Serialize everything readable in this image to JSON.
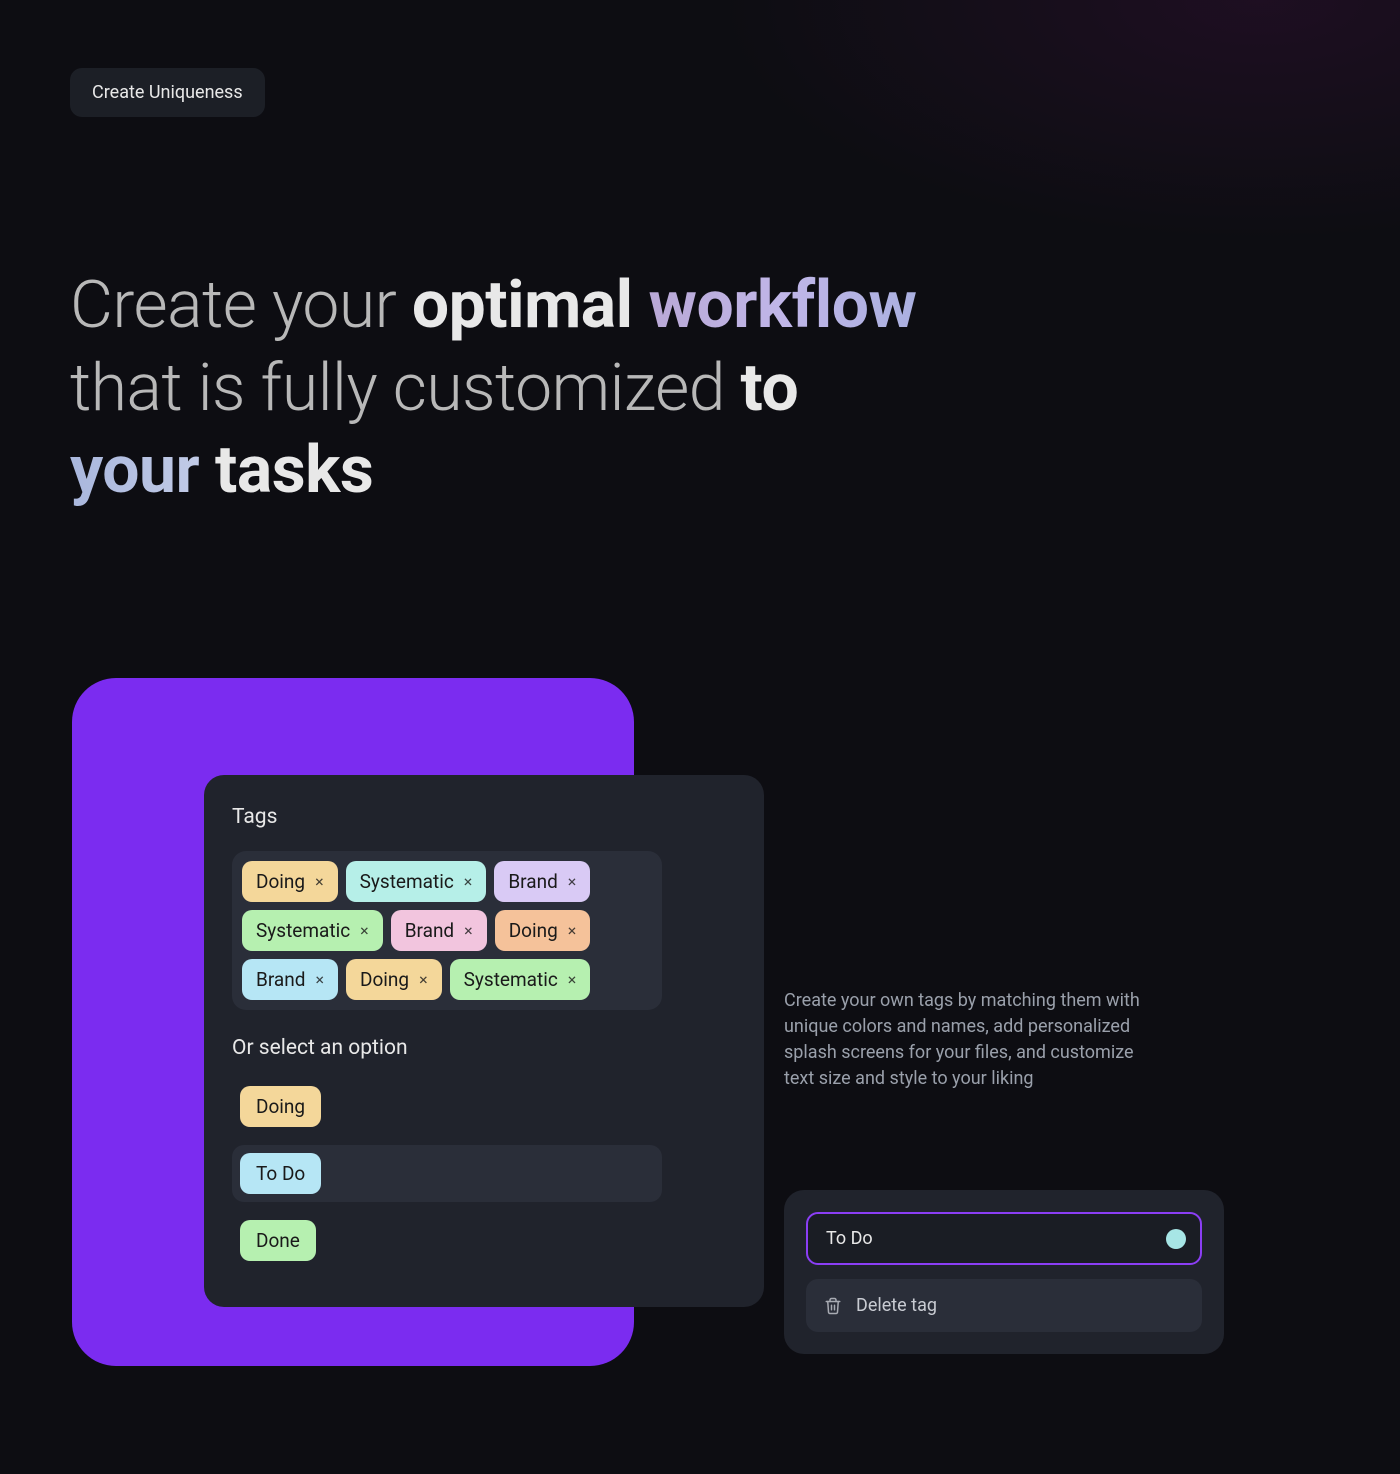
{
  "badge": "Create Uniqueness",
  "headline": {
    "part1": "Create your ",
    "bold1": "optimal ",
    "grad1": "workflow",
    "part2": "that is fully customized ",
    "bold2": "to",
    "grad2": "your ",
    "bold3": "tasks"
  },
  "tags_panel": {
    "title": "Tags",
    "rows": [
      [
        {
          "label": "Doing",
          "color": "#f4d79a"
        },
        {
          "label": "Systematic",
          "color": "#b6efe8"
        },
        {
          "label": "Brand",
          "color": "#d9caf5"
        }
      ],
      [
        {
          "label": "Systematic",
          "color": "#b6f0b0"
        },
        {
          "label": "Brand",
          "color": "#f2c5de"
        },
        {
          "label": "Doing",
          "color": "#f5c29a"
        }
      ],
      [
        {
          "label": "Brand",
          "color": "#b6e6f5"
        },
        {
          "label": "Doing",
          "color": "#f4d79a"
        },
        {
          "label": "Systematic",
          "color": "#b6f0b0"
        }
      ]
    ],
    "subhead": "Or select an option",
    "options": [
      {
        "label": "Doing",
        "color": "#f4d79a",
        "highlighted": false
      },
      {
        "label": "To Do",
        "color": "#b6e6f5",
        "highlighted": true
      },
      {
        "label": "Done",
        "color": "#b6f0b0",
        "highlighted": false
      }
    ]
  },
  "description": "Create your own tags by matching them with unique colors and names, add personalized splash screens for your files, and customize text size and style to your liking",
  "edit_card": {
    "input_value": "To Do",
    "swatch_color": "#a7e6e6",
    "delete_label": "Delete tag"
  }
}
